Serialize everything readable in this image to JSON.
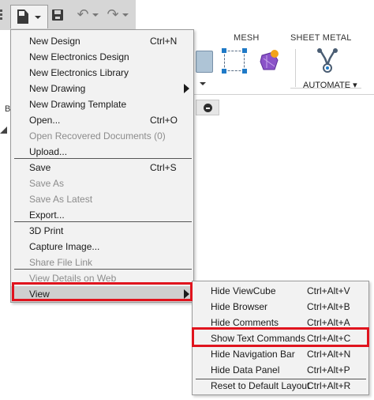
{
  "ribbon": {
    "tabs": [
      "MESH",
      "SHEET METAL"
    ],
    "automate_label": "AUTOMATE ▾"
  },
  "file_menu": {
    "items": [
      {
        "label": "New Design",
        "shortcut": "Ctrl+N",
        "enabled": true
      },
      {
        "label": "New Electronics Design",
        "shortcut": "",
        "enabled": true
      },
      {
        "label": "New Electronics Library",
        "shortcut": "",
        "enabled": true
      },
      {
        "label": "New Drawing",
        "shortcut": "",
        "enabled": true,
        "submenu": true
      },
      {
        "label": "New Drawing Template",
        "shortcut": "",
        "enabled": true
      },
      {
        "label": "Open...",
        "shortcut": "Ctrl+O",
        "enabled": true
      },
      {
        "label": "Open Recovered Documents (0)",
        "shortcut": "",
        "enabled": false
      },
      {
        "label": "Upload...",
        "shortcut": "",
        "enabled": true
      },
      {
        "label": "Save",
        "shortcut": "Ctrl+S",
        "enabled": true
      },
      {
        "label": "Save As",
        "shortcut": "",
        "enabled": false
      },
      {
        "label": "Save As Latest",
        "shortcut": "",
        "enabled": false
      },
      {
        "label": "Export...",
        "shortcut": "",
        "enabled": true
      },
      {
        "label": "3D Print",
        "shortcut": "",
        "enabled": true
      },
      {
        "label": "Capture Image...",
        "shortcut": "",
        "enabled": true
      },
      {
        "label": "Share File Link",
        "shortcut": "",
        "enabled": false
      },
      {
        "label": "View Details on Web",
        "shortcut": "",
        "enabled": false
      },
      {
        "label": "View",
        "shortcut": "",
        "enabled": true,
        "submenu": true,
        "highlighted": true
      }
    ]
  },
  "view_submenu": {
    "items": [
      {
        "label": "Hide ViewCube",
        "shortcut": "Ctrl+Alt+V"
      },
      {
        "label": "Hide Browser",
        "shortcut": "Ctrl+Alt+B"
      },
      {
        "label": "Hide Comments",
        "shortcut": "Ctrl+Alt+A"
      },
      {
        "label": "Show Text Commands",
        "shortcut": "Ctrl+Alt+C",
        "highlighted": true
      },
      {
        "label": "Hide Navigation Bar",
        "shortcut": "Ctrl+Alt+N"
      },
      {
        "label": "Hide Data Panel",
        "shortcut": "Ctrl+Alt+P"
      },
      {
        "label": "Reset to Default Layout",
        "shortcut": "Ctrl+Alt+R"
      }
    ]
  },
  "browser_edge_label": "B",
  "colors": {
    "highlight_box": "#e0141e",
    "menu_bg": "#f2f2f2",
    "toolbar_bg": "#d6d6d6"
  }
}
